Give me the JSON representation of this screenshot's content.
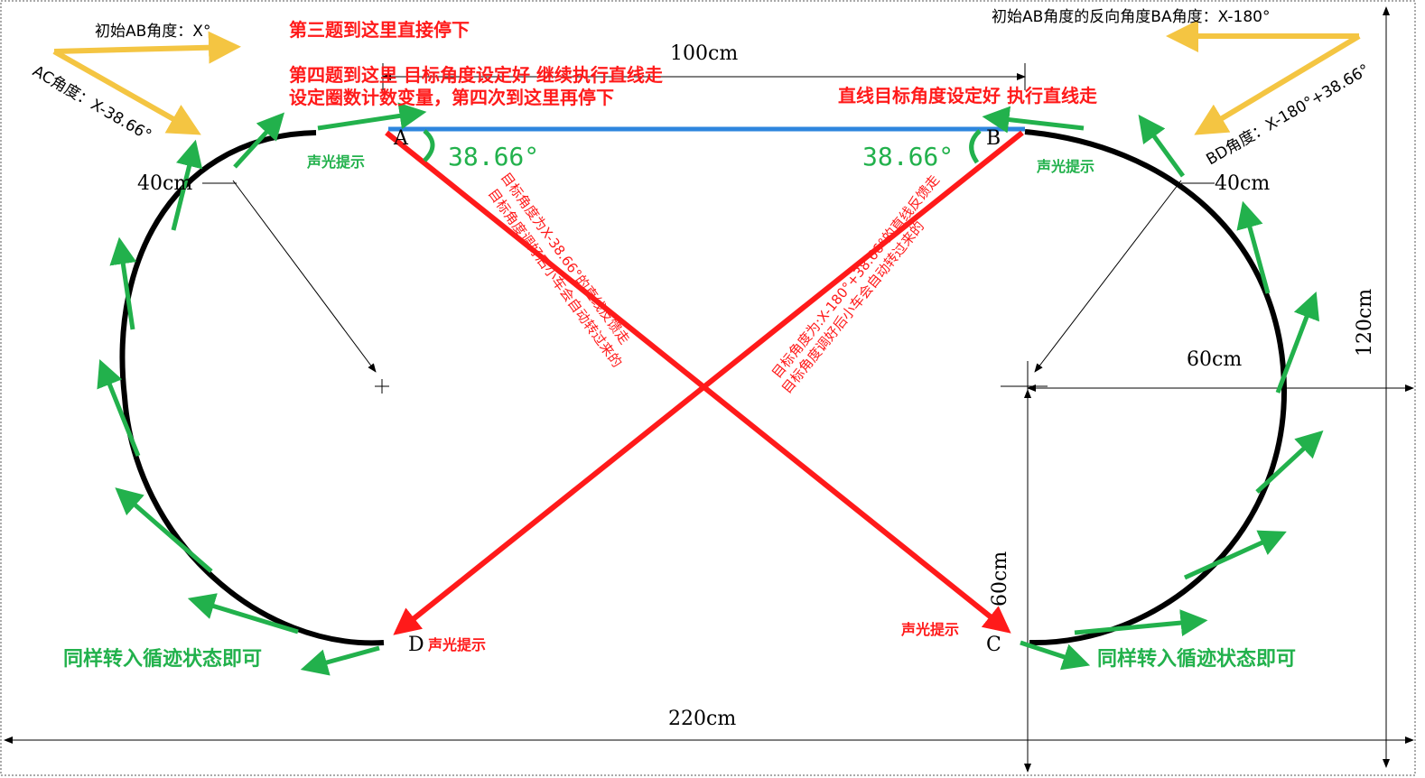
{
  "labels": {
    "point_a": "A",
    "point_b": "B",
    "point_c": "C",
    "point_d": "D",
    "dim_top": "100cm",
    "dim_bottom": "220cm",
    "dim_right_height": "120cm",
    "dim_right_radius": "60cm",
    "dim_vertical_radius": "60cm",
    "dim_left_40": "40cm",
    "dim_right_40": "40cm"
  },
  "notes": {
    "initial_ab_angle": "初始AB角度：X°",
    "ac_angle": "AC角度：X-38.66°",
    "initial_ba_angle": "初始AB角度的反向角度BA角度：X-180°",
    "bd_angle": "BD角度：X-180°+38.66°",
    "q3_stop": "第三题到这里直接停下",
    "q4_line1": "第四题到这里 目标角度设定好 继续执行直线走",
    "q4_line2": "设定圈数计数变量，第四次到这里再停下",
    "straight_b": "直线目标角度设定好 执行直线走",
    "angle_a": "38.66°",
    "angle_b": "38.66°",
    "beep_a": "声光提示",
    "beep_b": "声光提示",
    "beep_c": "声光提示",
    "beep_d": "声光提示",
    "ac_feedback_1": "目标角度为X-38.66°的直线反馈走",
    "ac_feedback_2": "目标角度调好后小车会自动转过来的",
    "bd_feedback_1": "目标角度为:X-180°+38.66°的直线反馈走",
    "bd_feedback_2": "目标角度调好后小车会自动转过来的",
    "follow_left": "同样转入循迹状态即可",
    "follow_right": "同样转入循迹状态即可"
  },
  "colors": {
    "track": "#000000",
    "line_ab": "#2e86de",
    "diagonals": "#ff1a1a",
    "arrows_green": "#22b14c",
    "arrows_yellow": "#f4c542",
    "text_red": "#ff1a1a",
    "text_green": "#22b14c",
    "dims": "#000000"
  }
}
